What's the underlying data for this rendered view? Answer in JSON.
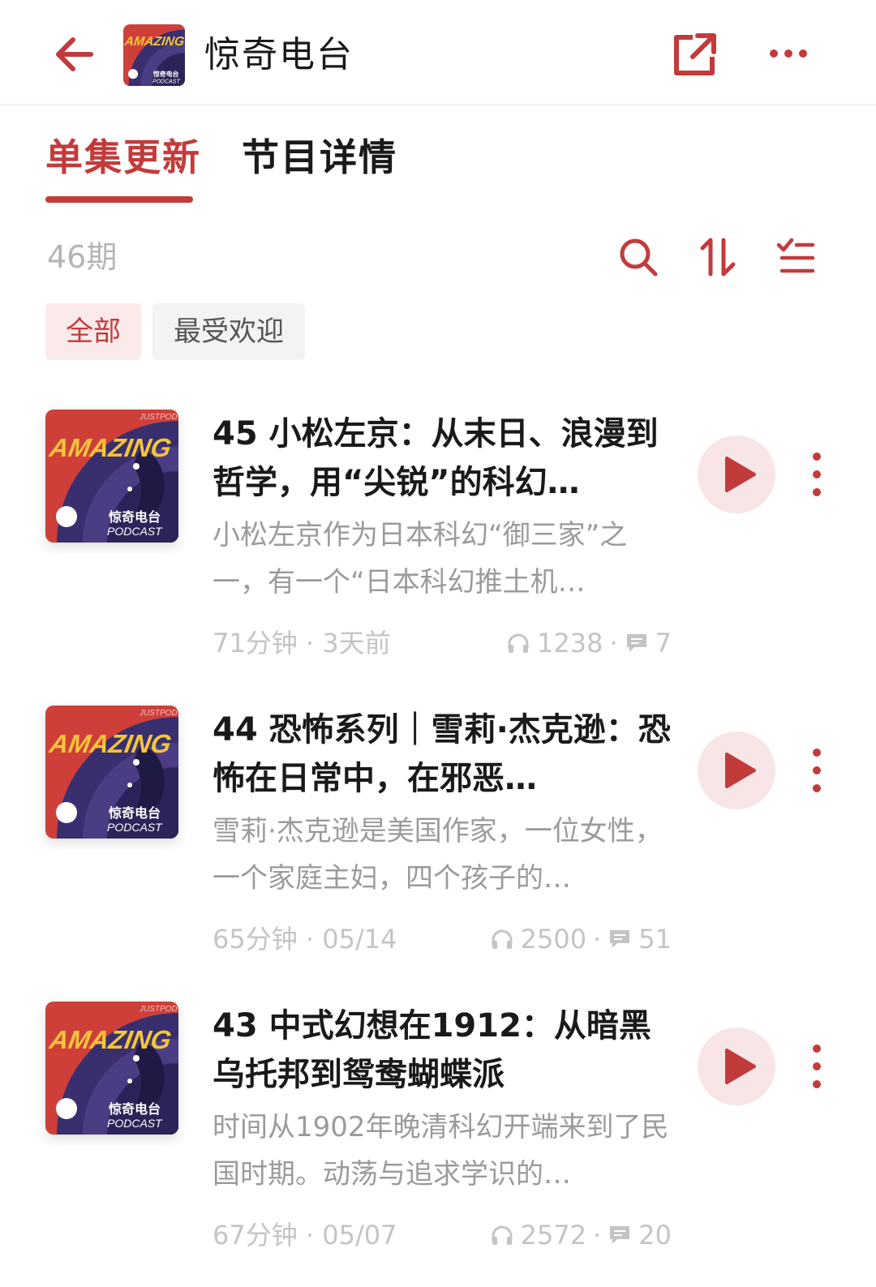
{
  "header": {
    "title": "惊奇电台",
    "back_icon": "arrow-left-icon",
    "share_icon": "share-external-icon",
    "more_icon": "more-horizontal-icon",
    "logo": {
      "brand_text": "AMAZING",
      "cn_text": "惊奇电台",
      "sub_text": "PODCAST",
      "tag_text": "JUSTPOD"
    }
  },
  "tabs": [
    {
      "label": "单集更新",
      "active": true
    },
    {
      "label": "节目详情",
      "active": false
    }
  ],
  "toolbar": {
    "count": "46期",
    "search_icon": "search-icon",
    "sort_icon": "sort-icon",
    "filter_icon": "filter-list-icon"
  },
  "chips": [
    {
      "label": "全部",
      "active": true
    },
    {
      "label": "最受欢迎",
      "active": false
    }
  ],
  "cover": {
    "brand_text": "AMAZING",
    "cn_text": "惊奇电台",
    "sub_text": "PODCAST",
    "tag_text": "JUSTPOD"
  },
  "episodes": [
    {
      "title": "45 小松左京：从末日、浪漫到哲学，用“尖锐”的科幻…",
      "description": "小松左京作为日本科幻“御三家”之一，有一个“日本科幻推土机…",
      "duration": "71分钟",
      "date": "3天前",
      "plays": "1238",
      "comments": "7"
    },
    {
      "title": "44 恐怖系列｜雪莉·杰克逊：恐怖在日常中，在邪恶…",
      "description": "雪莉·杰克逊是美国作家，一位女性，一个家庭主妇，四个孩子的…",
      "duration": "65分钟",
      "date": "05/14",
      "plays": "2500",
      "comments": "51"
    },
    {
      "title": "43 中式幻想在1912：从暗黑乌托邦到鸳鸯蝴蝶派",
      "description": "时间从1902年晚清科幻开端来到了民国时期。动荡与追求学识的…",
      "duration": "67分钟",
      "date": "05/07",
      "plays": "2572",
      "comments": "20"
    }
  ],
  "meta_separator": " · ",
  "colors": {
    "accent": "#c23b3b",
    "play_bg": "#f8e6e6",
    "chip_active_bg": "#fbeaea",
    "muted_text": "#9b9b9b",
    "meta_text": "#c4c4c4"
  }
}
